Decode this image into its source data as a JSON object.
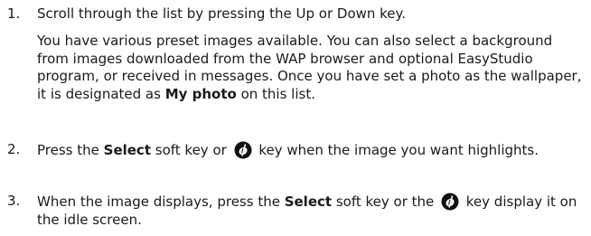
{
  "steps": [
    {
      "number": "1.",
      "text": "Scroll through the list by pressing the Up or Down key."
    },
    {
      "number": "2.",
      "before_bold": "Press the ",
      "bold": "Select",
      "middle": " soft key or ",
      "after_icon": " key when the image you want highlights."
    },
    {
      "number": "3.",
      "before_bold": "When the image displays, press the ",
      "bold": "Select",
      "middle": " soft key or the ",
      "after_icon": " key display it on the idle screen."
    }
  ],
  "note": {
    "text": "You have various preset images available. You can also select a background from images downloaded from the WAP browser and optional EasyStudio program, or received in messages. Once you have set a photo as the wallpaper, it is designated as ",
    "bold": "My photo",
    "after_bold": " on this list."
  },
  "icons": {
    "ok_key": "ok-key-icon",
    "ok_key_color": "#111111"
  }
}
